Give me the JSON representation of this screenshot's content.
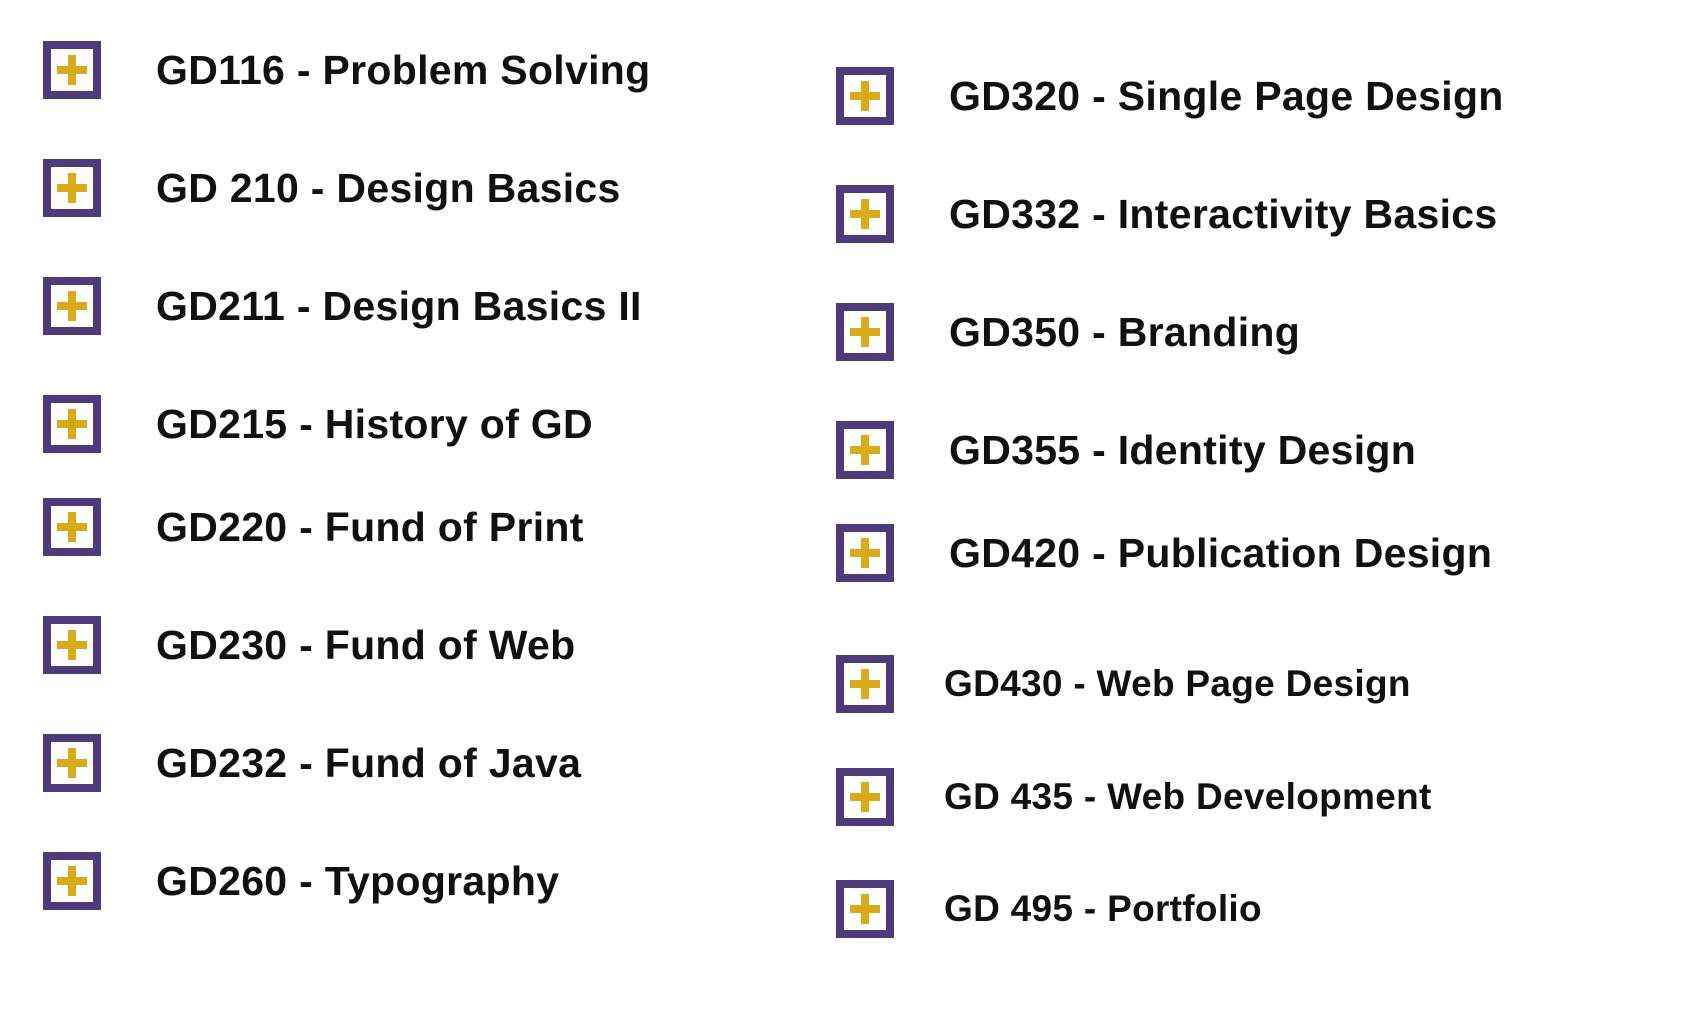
{
  "colors": {
    "toggle_border": "#4f3a7c",
    "plus": "#d9ab1b",
    "text": "#111111",
    "background": "#ffffff"
  },
  "toggle_icon": "plus-icon",
  "courses_left": [
    {
      "label": "GD116 - Problem Solving"
    },
    {
      "label": "GD 210 - Design Basics"
    },
    {
      "label": "GD211 - Design Basics II"
    },
    {
      "label": "GD215 - History of GD"
    },
    {
      "label": "GD220 - Fund of Print"
    },
    {
      "label": "GD230 - Fund of Web"
    },
    {
      "label": "GD232 - Fund of Java"
    },
    {
      "label": "GD260 - Typography"
    }
  ],
  "courses_right": [
    {
      "label": "GD320 - Single Page Design"
    },
    {
      "label": "GD332 - Interactivity Basics"
    },
    {
      "label": "GD350 - Branding"
    },
    {
      "label": "GD355 - Identity Design"
    },
    {
      "label": "GD420 - Publication Design"
    },
    {
      "label": "GD430 - Web Page Design"
    },
    {
      "label": "GD 435 - Web Development"
    },
    {
      "label": "GD 495 - Portfolio"
    }
  ]
}
